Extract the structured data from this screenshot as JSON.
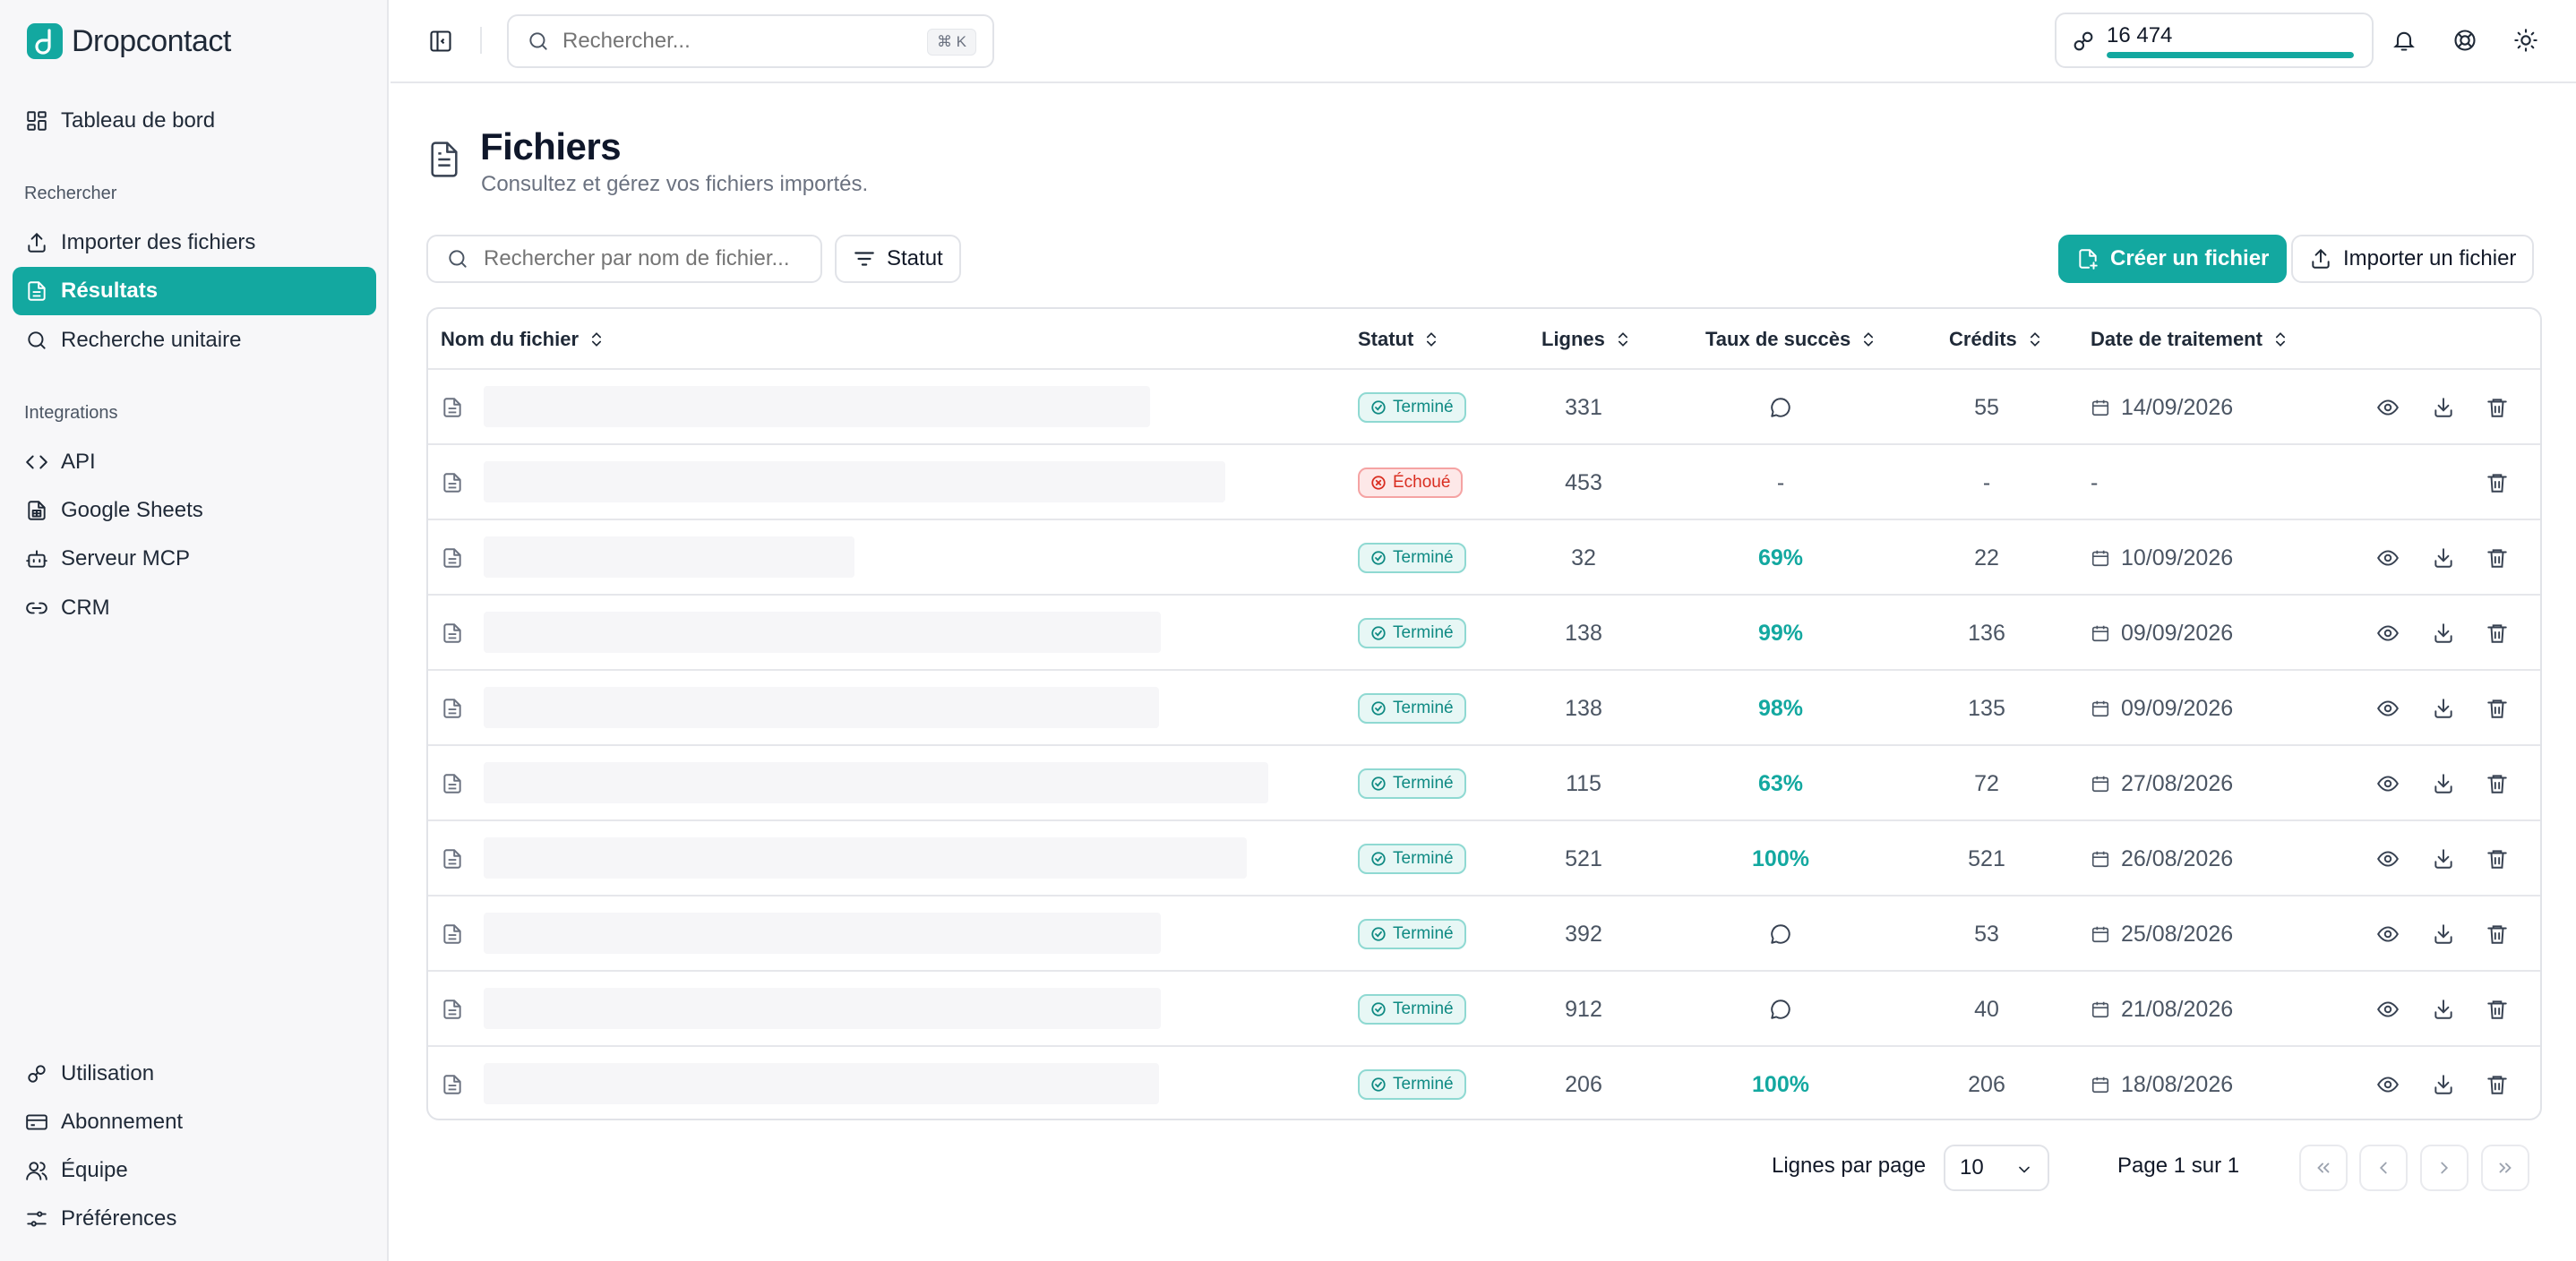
{
  "app": {
    "name": "Dropcontact"
  },
  "colors": {
    "accent": "#13a8a0",
    "success_bg": "#e7f7f5",
    "fail_text": "#d92d20"
  },
  "sidebar": {
    "dashboard": {
      "label": "Tableau de bord",
      "icon": "dashboard-icon"
    },
    "sections": [
      {
        "title": "Rechercher",
        "items": [
          {
            "label": "Importer des fichiers",
            "icon": "upload-icon"
          },
          {
            "label": "Résultats",
            "icon": "document-icon",
            "active": true
          },
          {
            "label": "Recherche unitaire",
            "icon": "search-icon"
          }
        ]
      },
      {
        "title": "Integrations",
        "items": [
          {
            "label": "API",
            "icon": "code-icon"
          },
          {
            "label": "Google Sheets",
            "icon": "sheet-icon"
          },
          {
            "label": "Serveur MCP",
            "icon": "bot-icon"
          },
          {
            "label": "CRM",
            "icon": "link-icon"
          }
        ]
      }
    ],
    "bottom": [
      {
        "label": "Utilisation",
        "icon": "usage-icon"
      },
      {
        "label": "Abonnement",
        "icon": "card-icon"
      },
      {
        "label": "Équipe",
        "icon": "team-icon"
      },
      {
        "label": "Préférences",
        "icon": "preferences-icon"
      }
    ]
  },
  "topbar": {
    "search_placeholder": "Rechercher...",
    "shortcut": "⌘ K",
    "credits": {
      "value": "16 474",
      "fill_fraction": 1.0
    }
  },
  "page": {
    "title": "Fichiers",
    "subtitle": "Consultez et gérez vos fichiers importés."
  },
  "toolbar": {
    "search_placeholder": "Rechercher par nom de fichier...",
    "filter_label": "Statut",
    "create_label": "Créer un fichier",
    "import_label": "Importer un fichier"
  },
  "table": {
    "columns": {
      "name": "Nom du fichier",
      "status": "Statut",
      "lines": "Lignes",
      "success": "Taux de succès",
      "credits": "Crédits",
      "date": "Date de traitement"
    },
    "rows": [
      {
        "status": "Terminé",
        "status_kind": "ok",
        "lines": "331",
        "success": "",
        "success_kind": "comment",
        "credits": "55",
        "date": "14/09/2026",
        "actions": true
      },
      {
        "status": "Échoué",
        "status_kind": "fail",
        "lines": "453",
        "success": "-",
        "success_kind": "dash",
        "credits": "-",
        "date": "-",
        "actions": false
      },
      {
        "status": "Terminé",
        "status_kind": "ok",
        "lines": "32",
        "success": "69%",
        "success_kind": "pct",
        "credits": "22",
        "date": "10/09/2026",
        "actions": true
      },
      {
        "status": "Terminé",
        "status_kind": "ok",
        "lines": "138",
        "success": "99%",
        "success_kind": "pct",
        "credits": "136",
        "date": "09/09/2026",
        "actions": true
      },
      {
        "status": "Terminé",
        "status_kind": "ok",
        "lines": "138",
        "success": "98%",
        "success_kind": "pct",
        "credits": "135",
        "date": "09/09/2026",
        "actions": true
      },
      {
        "status": "Terminé",
        "status_kind": "ok",
        "lines": "115",
        "success": "63%",
        "success_kind": "pct",
        "credits": "72",
        "date": "27/08/2026",
        "actions": true
      },
      {
        "status": "Terminé",
        "status_kind": "ok",
        "lines": "521",
        "success": "100%",
        "success_kind": "pct",
        "credits": "521",
        "date": "26/08/2026",
        "actions": true
      },
      {
        "status": "Terminé",
        "status_kind": "ok",
        "lines": "392",
        "success": "",
        "success_kind": "comment",
        "credits": "53",
        "date": "25/08/2026",
        "actions": true
      },
      {
        "status": "Terminé",
        "status_kind": "ok",
        "lines": "912",
        "success": "",
        "success_kind": "comment",
        "credits": "40",
        "date": "21/08/2026",
        "actions": true
      },
      {
        "status": "Terminé",
        "status_kind": "ok",
        "lines": "206",
        "success": "100%",
        "success_kind": "pct",
        "credits": "206",
        "date": "18/08/2026",
        "actions": true
      }
    ]
  },
  "pagination": {
    "rows_per_page_label": "Lignes par page",
    "rows_per_page_value": "10",
    "page_info": "Page 1 sur 1"
  }
}
